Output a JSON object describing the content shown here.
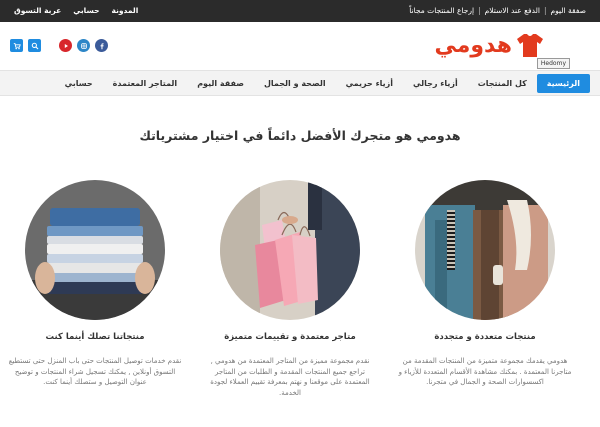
{
  "topbar": {
    "right_links": [
      "صفقة اليوم",
      "الدفع عند الاستلام",
      "إرجاع المنتجات مجاناً"
    ],
    "left_links": [
      "المدونة",
      "حسابي",
      "عربة التسوق"
    ]
  },
  "header": {
    "logo_text": "هدومي",
    "tooltip": "Hedomy",
    "colors": {
      "brand": "#e23a1e",
      "accent": "#1f8ce0",
      "topbar": "#2b2b2b"
    },
    "social_icons": [
      "cart-icon",
      "search-icon",
      "youtube-icon",
      "instagram-icon",
      "facebook-icon"
    ]
  },
  "nav": {
    "items": [
      "الرئيسية",
      "كل المنتجات",
      "أزياء رجالي",
      "أزياء حريمي",
      "الصحة و الجمال",
      "صفقة اليوم",
      "المتاجر المعتمدة",
      "حسابي"
    ]
  },
  "main": {
    "headline": "هدومي هو متجرك الأفضل دائماً في اختيار مشترياتك",
    "features": [
      {
        "title": "منتجات متعددة و متجددة",
        "text": "هدومي يقدمك مجموعة متميزة من المنتجات المقدمة من متاجرنا المعتمدة . بمكنك مشاهدة الأقسام المتعددة للأزياء و اكسسوارات الصحة و الجمال في متجرنا."
      },
      {
        "title": "متاجر معتمدة و تقييمات متميزة",
        "text": "نقدم مجموعة مميزة من المتاجر المعتمدة من هدومي , تراجع جميع المنتجات المقدمة و الطلبات من المتاجر المعتمدة على موقعنا و نهتم بمعرفة تقييم العملاء لجودة الخدمة."
      },
      {
        "title": "منتجاتنا تصلك أينما كنت",
        "text": "نقدم خدمات توصيل المنتجات حتى باب المنزل حتى تستطيع التسوق أونلاين , يمكنك تسجيل شراء المنتجات و توضيح عنوان التوصيل و ستصلك أينما كنت."
      }
    ]
  }
}
